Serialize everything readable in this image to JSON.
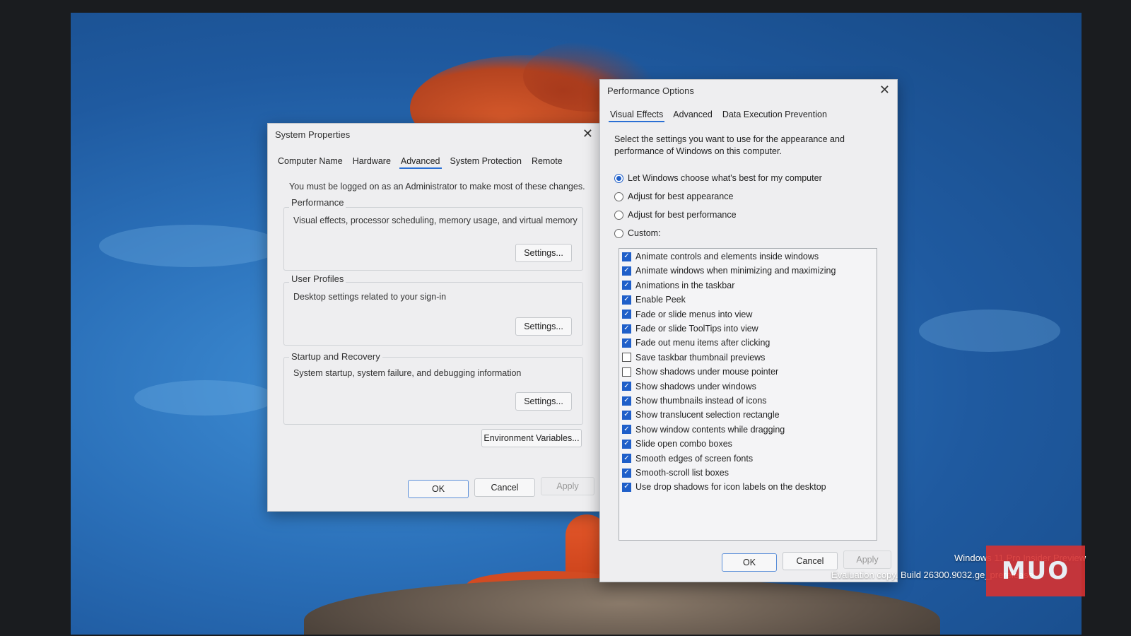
{
  "system_properties": {
    "title": "System Properties",
    "tabs": [
      "Computer Name",
      "Hardware",
      "Advanced",
      "System Protection",
      "Remote"
    ],
    "active_tab": "Advanced",
    "admin_note": "You must be logged on as an Administrator to make most of these changes.",
    "performance": {
      "label": "Performance",
      "desc": "Visual effects, processor scheduling, memory usage, and virtual memory",
      "button": "Settings..."
    },
    "user_profiles": {
      "label": "User Profiles",
      "desc": "Desktop settings related to your sign-in",
      "button": "Settings..."
    },
    "startup_recovery": {
      "label": "Startup and Recovery",
      "desc": "System startup, system failure, and debugging information",
      "button": "Settings..."
    },
    "env_button": "Environment Variables...",
    "ok": "OK",
    "cancel": "Cancel",
    "apply": "Apply"
  },
  "performance_options": {
    "title": "Performance Options",
    "tabs": [
      "Visual Effects",
      "Advanced",
      "Data Execution Prevention"
    ],
    "active_tab": "Visual Effects",
    "intro": "Select the settings you want to use for the appearance and performance of Windows on this computer.",
    "radios": [
      {
        "label": "Let Windows choose what's best for my computer",
        "selected": true
      },
      {
        "label": "Adjust for best appearance",
        "selected": false
      },
      {
        "label": "Adjust for best performance",
        "selected": false
      },
      {
        "label": "Custom:",
        "selected": false
      }
    ],
    "effects": [
      {
        "label": "Animate controls and elements inside windows",
        "checked": true
      },
      {
        "label": "Animate windows when minimizing and maximizing",
        "checked": true
      },
      {
        "label": "Animations in the taskbar",
        "checked": true
      },
      {
        "label": "Enable Peek",
        "checked": true
      },
      {
        "label": "Fade or slide menus into view",
        "checked": true
      },
      {
        "label": "Fade or slide ToolTips into view",
        "checked": true
      },
      {
        "label": "Fade out menu items after clicking",
        "checked": true
      },
      {
        "label": "Save taskbar thumbnail previews",
        "checked": false
      },
      {
        "label": "Show shadows under mouse pointer",
        "checked": false
      },
      {
        "label": "Show shadows under windows",
        "checked": true
      },
      {
        "label": "Show thumbnails instead of icons",
        "checked": true
      },
      {
        "label": "Show translucent selection rectangle",
        "checked": true
      },
      {
        "label": "Show window contents while dragging",
        "checked": true
      },
      {
        "label": "Slide open combo boxes",
        "checked": true
      },
      {
        "label": "Smooth edges of screen fonts",
        "checked": true
      },
      {
        "label": "Smooth-scroll list boxes",
        "checked": true
      },
      {
        "label": "Use drop shadows for icon labels on the desktop",
        "checked": true
      }
    ],
    "ok": "OK",
    "cancel": "Cancel",
    "apply": "Apply"
  },
  "watermark": {
    "line1": "Windows 11 Pro Insider Preview",
    "line2": "Evaluation copy. Build 26300.9032.ge_prerelease"
  },
  "logo": "MUO",
  "colors": {
    "accent": "#1f5fc9",
    "wallpaper": "#2a6fb8",
    "logo": "#d63232"
  }
}
